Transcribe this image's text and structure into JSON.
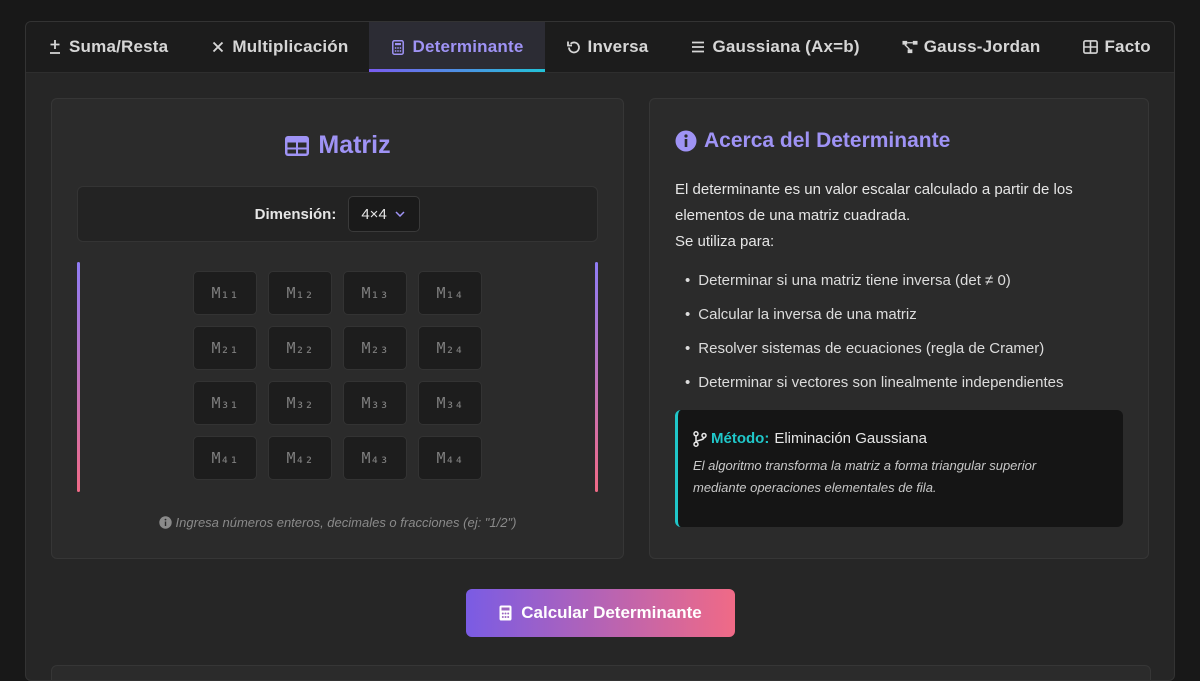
{
  "tabs": [
    {
      "label": "Suma/Resta",
      "icon": "plus-minus-icon"
    },
    {
      "label": "Multiplicación",
      "icon": "times-icon"
    },
    {
      "label": "Determinante",
      "icon": "calculator-icon",
      "active": true
    },
    {
      "label": "Inversa",
      "icon": "undo-icon"
    },
    {
      "label": "Gaussiana (Ax=b)",
      "icon": "lines-icon"
    },
    {
      "label": "Gauss-Jordan",
      "icon": "project-diagram-icon"
    },
    {
      "label": "Facto",
      "icon": "table-icon"
    }
  ],
  "matrix_card": {
    "title": "Matriz",
    "dimension_label": "Dimensión:",
    "dimension_value": "4×4",
    "cells": [
      [
        "M₁₁",
        "M₁₂",
        "M₁₃",
        "M₁₄"
      ],
      [
        "M₂₁",
        "M₂₂",
        "M₂₃",
        "M₂₄"
      ],
      [
        "M₃₁",
        "M₃₂",
        "M₃₃",
        "M₃₄"
      ],
      [
        "M₄₁",
        "M₄₂",
        "M₄₃",
        "M₄₄"
      ]
    ],
    "hint": "Ingresa números enteros, decimales o fracciones (ej: \"1/2\")"
  },
  "info_card": {
    "title": "Acerca del Determinante",
    "desc_line1": "El determinante es un valor escalar calculado a partir de los elementos de una matriz cuadrada.",
    "desc_line2": "Se utiliza para:",
    "uses": [
      "Determinar si una matriz tiene inversa (det ≠ 0)",
      "Calcular la inversa de una matriz",
      "Resolver sistemas de ecuaciones (regla de Cramer)",
      "Determinar si vectores son linealmente independientes"
    ],
    "method_label": "Método:",
    "method_value": "Eliminación Gaussiana",
    "method_text": "El algoritmo transforma la matriz a forma triangular superior mediante operaciones elementales de fila."
  },
  "calc_button": {
    "label": "Calcular Determinante"
  },
  "colors": {
    "accent": "#9f93f5",
    "teal": "#20c7c9",
    "gradient_start": "#7a5ce4",
    "gradient_end": "#f06a86"
  }
}
